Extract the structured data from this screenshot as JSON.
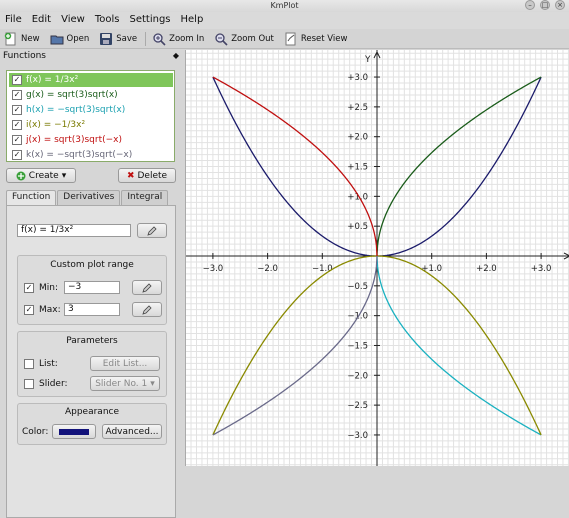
{
  "window": {
    "title": "KmPlot"
  },
  "menu": [
    "File",
    "Edit",
    "View",
    "Tools",
    "Settings",
    "Help"
  ],
  "toolbar": {
    "new_label": "New",
    "open_label": "Open",
    "save_label": "Save",
    "zoom_in_label": "Zoom In",
    "zoom_out_label": "Zoom Out",
    "reset_view_label": "Reset View"
  },
  "functions_panel": {
    "title": "Functions",
    "items": [
      {
        "label": "f(x) = 1/3x²",
        "color": "#1c1c6b",
        "checked": true,
        "selected": true
      },
      {
        "label": "g(x) = sqrt(3)sqrt(x)",
        "color": "#1a5c1a",
        "checked": true
      },
      {
        "label": "h(x) = −sqrt(3)sqrt(x)",
        "color": "#1ab1c0",
        "checked": true
      },
      {
        "label": "i(x) = −1/3x²",
        "color": "#8a8a00",
        "checked": true
      },
      {
        "label": "j(x) = sqrt(3)sqrt(−x)",
        "color": "#c01010",
        "checked": true
      },
      {
        "label": "k(x) = −sqrt(3)sqrt(−x)",
        "color": "#555577",
        "checked": true
      }
    ],
    "create_label": "Create",
    "delete_label": "Delete"
  },
  "editor": {
    "tabs": [
      "Function",
      "Derivatives",
      "Integral"
    ],
    "equation": "f(x) = 1/3x²",
    "plot_range": {
      "title": "Custom plot range",
      "min_label": "Min:",
      "min_value": "−3",
      "max_label": "Max:",
      "max_value": "3"
    },
    "parameters": {
      "title": "Parameters",
      "list_label": "List:",
      "edit_list_label": "Edit List...",
      "slider_label": "Slider:",
      "slider_value": "Slider No. 1"
    },
    "appearance": {
      "title": "Appearance",
      "color_label": "Color:",
      "color": "#12127a",
      "advanced_label": "Advanced..."
    }
  },
  "plot": {
    "y_axis_label": "Y",
    "x_ticks": [
      "−3.0",
      "−2.0",
      "−1.0",
      "+1.0",
      "+2.0",
      "+3.0"
    ],
    "y_ticks": [
      "+3.0",
      "+2.5",
      "+2.0",
      "+1.5",
      "+1.0",
      "+0.5",
      "−0.5",
      "−1.0",
      "−1.5",
      "−2.0",
      "−2.5",
      "−3.0"
    ]
  },
  "chart_data": {
    "type": "line",
    "xlim": [
      -3,
      3
    ],
    "ylim": [
      -3,
      3
    ],
    "grid": true,
    "series": [
      {
        "name": "f(x) = 1/3x²",
        "fn": "f",
        "color": "#1c1c6b",
        "x_range": [
          -3,
          3
        ]
      },
      {
        "name": "g(x) = sqrt(3)sqrt(x)",
        "fn": "g",
        "color": "#1a5c1a",
        "x_range": [
          0,
          3
        ]
      },
      {
        "name": "h(x) = −sqrt(3)sqrt(x)",
        "fn": "h",
        "color": "#1ab1c0",
        "x_range": [
          0,
          3
        ]
      },
      {
        "name": "i(x) = −1/3x²",
        "fn": "i",
        "color": "#8a8a00",
        "x_range": [
          -3,
          3
        ]
      },
      {
        "name": "j(x) = sqrt(3)sqrt(−x)",
        "fn": "j",
        "color": "#c01010",
        "x_range": [
          -3,
          0
        ]
      },
      {
        "name": "k(x) = −sqrt(3)sqrt(−x)",
        "fn": "k",
        "color": "#6a6a8a",
        "x_range": [
          -3,
          0
        ]
      }
    ]
  }
}
